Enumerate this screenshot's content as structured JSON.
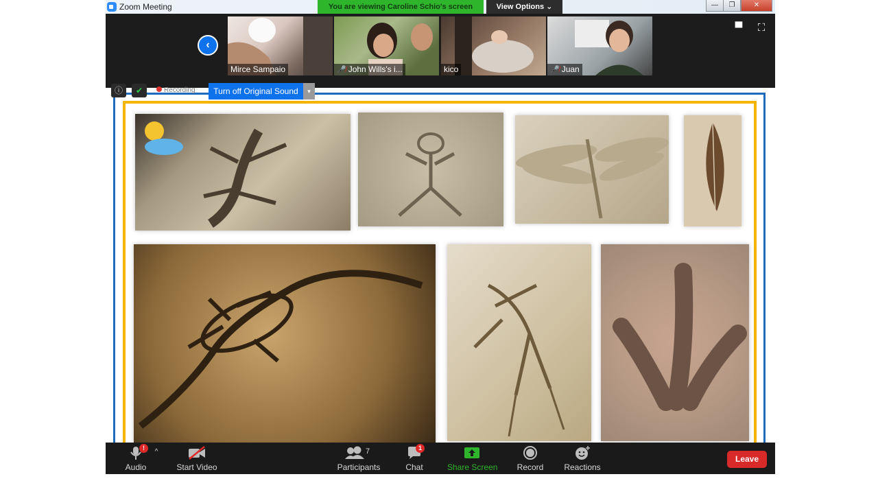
{
  "window": {
    "title": "Zoom Meeting",
    "viewing_banner": "You are viewing Caroline Schio's screen",
    "view_options_label": "View Options ⌄",
    "controls": {
      "minimize": "—",
      "maximize": "❐",
      "close": "✕"
    }
  },
  "participants": [
    {
      "name": "Mirce Sampaio",
      "muted": false
    },
    {
      "name": "John Wills's i...",
      "muted": true
    },
    {
      "name": "kico",
      "muted": false
    },
    {
      "name": "Juan",
      "muted": true
    }
  ],
  "share_toolbar": {
    "recording_label": "Recording",
    "original_sound_button": "Turn off Original Sound"
  },
  "toolbar": {
    "audio": "Audio",
    "audio_badge": "!",
    "start_video": "Start Video",
    "participants": "Participants",
    "participants_count": "7",
    "chat": "Chat",
    "chat_badge": "1",
    "share_screen": "Share Screen",
    "record": "Record",
    "reactions": "Reactions",
    "leave": "Leave"
  },
  "colors": {
    "share_green": "#2fb52c",
    "leave_red": "#d92a2a",
    "accent_blue": "#0e72ed",
    "frame_blue": "#1f6bbd",
    "frame_yellow": "#f4b400"
  }
}
